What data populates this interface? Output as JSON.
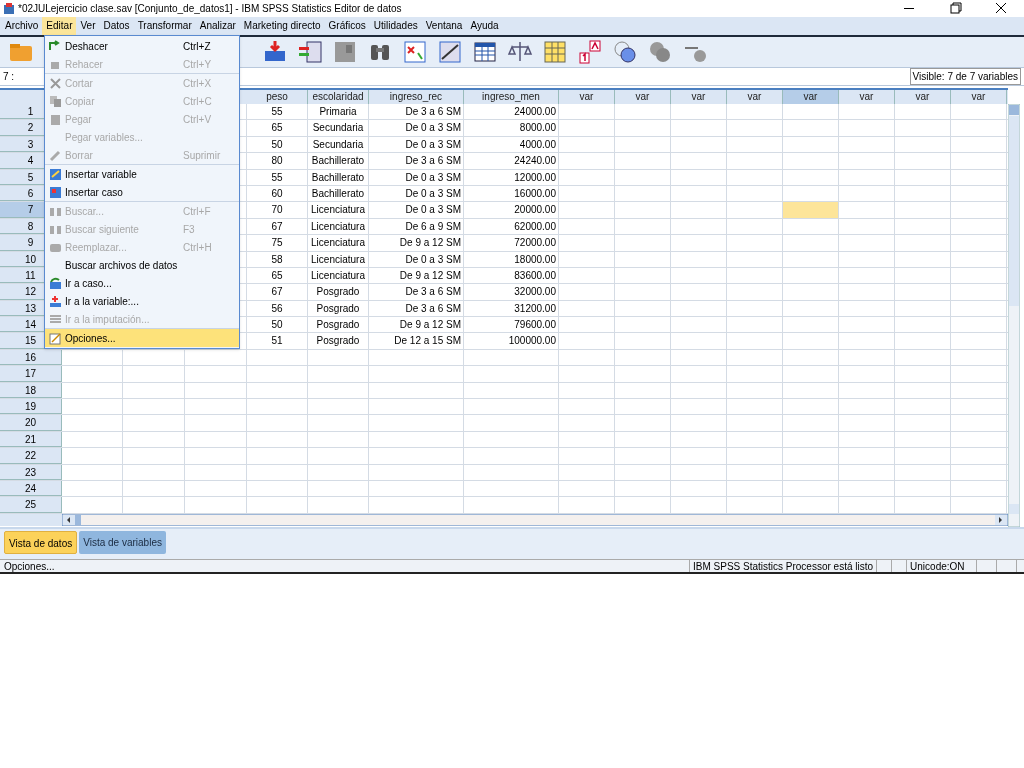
{
  "window": {
    "title": "*02JULejercicio clase.sav [Conjunto_de_datos1] - IBM SPSS Statistics Editor de datos"
  },
  "menu_bar": [
    {
      "label": "Archivo",
      "selected": false
    },
    {
      "label": "Editar",
      "selected": true
    },
    {
      "label": "Ver",
      "selected": false
    },
    {
      "label": "Datos",
      "selected": false
    },
    {
      "label": "Transformar",
      "selected": false
    },
    {
      "label": "Analizar",
      "selected": false
    },
    {
      "label": "Marketing directo",
      "selected": false
    },
    {
      "label": "Gráficos",
      "selected": false
    },
    {
      "label": "Utilidades",
      "selected": false
    },
    {
      "label": "Ventana",
      "selected": false
    },
    {
      "label": "Ayuda",
      "selected": false
    }
  ],
  "edit_menu": [
    {
      "label": "Deshacer",
      "shortcut": "Ctrl+Z",
      "disabled": false,
      "selected": false,
      "separator_before": false
    },
    {
      "label": "Rehacer",
      "shortcut": "Ctrl+Y",
      "disabled": true,
      "selected": false,
      "separator_before": false
    },
    {
      "label": "Cortar",
      "shortcut": "Ctrl+X",
      "disabled": true,
      "selected": false,
      "separator_before": true
    },
    {
      "label": "Copiar",
      "shortcut": "Ctrl+C",
      "disabled": true,
      "selected": false,
      "separator_before": false
    },
    {
      "label": "Pegar",
      "shortcut": "Ctrl+V",
      "disabled": true,
      "selected": false,
      "separator_before": false
    },
    {
      "label": "Pegar variables...",
      "disabled": true,
      "selected": false,
      "separator_before": false
    },
    {
      "label": "Borrar",
      "shortcut": "Suprimir",
      "disabled": true,
      "selected": false,
      "separator_before": false
    },
    {
      "label": "Insertar variable",
      "disabled": false,
      "selected": false,
      "separator_before": true
    },
    {
      "label": "Insertar caso",
      "disabled": false,
      "selected": false,
      "separator_before": false
    },
    {
      "label": "Buscar...",
      "shortcut": "Ctrl+F",
      "disabled": true,
      "selected": false,
      "separator_before": true
    },
    {
      "label": "Buscar siguiente",
      "shortcut": "F3",
      "disabled": true,
      "selected": false,
      "separator_before": false
    },
    {
      "label": "Reemplazar...",
      "shortcut": "Ctrl+H",
      "disabled": true,
      "selected": false,
      "separator_before": false
    },
    {
      "label": "Buscar archivos de datos",
      "disabled": false,
      "selected": false,
      "separator_before": false
    },
    {
      "label": "Ir a caso...",
      "disabled": false,
      "selected": false,
      "separator_before": false
    },
    {
      "label": "Ir a la variable:...",
      "disabled": false,
      "selected": false,
      "separator_before": false
    },
    {
      "label": "Ir a la imputación...",
      "disabled": true,
      "selected": false,
      "separator_before": false
    },
    {
      "label": "Opciones...",
      "disabled": false,
      "selected": true,
      "separator_before": true
    }
  ],
  "cell_reference": "7 :",
  "visible_vars": "Visible: 7 de 7 variables",
  "columns": [
    {
      "label": "peso",
      "selected": false
    },
    {
      "label": "escolaridad",
      "selected": false
    },
    {
      "label": "ingreso_rec",
      "selected": false
    },
    {
      "label": "ingreso_men",
      "selected": false
    },
    {
      "label": "var",
      "selected": false
    },
    {
      "label": "var",
      "selected": false
    },
    {
      "label": "var",
      "selected": false
    },
    {
      "label": "var",
      "selected": false
    },
    {
      "label": "var",
      "selected": true
    },
    {
      "label": "var",
      "selected": false
    },
    {
      "label": "var",
      "selected": false
    },
    {
      "label": "var",
      "selected": false
    }
  ],
  "rows": [
    {
      "number": "1",
      "selected": false,
      "peso": "55",
      "escolaridad": "Primaria",
      "ingreso_rec": "De 3 a 6 SM",
      "ingreso_men": "24000.00"
    },
    {
      "number": "2",
      "selected": false,
      "peso": "65",
      "escolaridad": "Secundaria",
      "ingreso_rec": "De 0 a 3 SM",
      "ingreso_men": "8000.00"
    },
    {
      "number": "3",
      "selected": false,
      "peso": "50",
      "escolaridad": "Secundaria",
      "ingreso_rec": "De 0 a 3 SM",
      "ingreso_men": "4000.00"
    },
    {
      "number": "4",
      "selected": false,
      "peso": "80",
      "escolaridad": "Bachillerato",
      "ingreso_rec": "De 3 a 6 SM",
      "ingreso_men": "24240.00"
    },
    {
      "number": "5",
      "selected": false,
      "peso": "55",
      "escolaridad": "Bachillerato",
      "ingreso_rec": "De 0 a 3 SM",
      "ingreso_men": "12000.00"
    },
    {
      "number": "6",
      "selected": false,
      "peso": "60",
      "escolaridad": "Bachillerato",
      "ingreso_rec": "De 0 a 3 SM",
      "ingreso_men": "16000.00"
    },
    {
      "number": "7",
      "selected": true,
      "peso": "70",
      "escolaridad": "Licenciatura",
      "ingreso_rec": "De 0 a 3 SM",
      "ingreso_men": "20000.00"
    },
    {
      "number": "8",
      "selected": false,
      "peso": "67",
      "escolaridad": "Licenciatura",
      "ingreso_rec": "De 6 a 9 SM",
      "ingreso_men": "62000.00"
    },
    {
      "number": "9",
      "selected": false,
      "peso": "75",
      "escolaridad": "Licenciatura",
      "ingreso_rec": "De 9 a 12 SM",
      "ingreso_men": "72000.00"
    },
    {
      "number": "10",
      "selected": false,
      "peso": "58",
      "escolaridad": "Licenciatura",
      "ingreso_rec": "De 0 a 3 SM",
      "ingreso_men": "18000.00"
    },
    {
      "number": "11",
      "selected": false,
      "peso": "65",
      "escolaridad": "Licenciatura",
      "ingreso_rec": "De 9 a 12 SM",
      "ingreso_men": "83600.00"
    },
    {
      "number": "12",
      "selected": false,
      "peso": "67",
      "escolaridad": "Posgrado",
      "ingreso_rec": "De 3 a 6 SM",
      "ingreso_men": "32000.00"
    },
    {
      "number": "13",
      "selected": false,
      "peso": "56",
      "escolaridad": "Posgrado",
      "ingreso_rec": "De 3 a 6 SM",
      "ingreso_men": "31200.00"
    },
    {
      "number": "14",
      "selected": false,
      "peso": "50",
      "escolaridad": "Posgrado",
      "ingreso_rec": "De 9 a 12 SM",
      "ingreso_men": "79600.00"
    },
    {
      "number": "15",
      "selected": false,
      "peso": "51",
      "escolaridad": "Posgrado",
      "ingreso_rec": "De 12 a 15 SM",
      "ingreso_men": "100000.00"
    },
    {
      "number": "16",
      "selected": false
    },
    {
      "number": "17",
      "selected": false
    },
    {
      "number": "18",
      "selected": false
    },
    {
      "number": "19",
      "selected": false
    },
    {
      "number": "20",
      "selected": false
    },
    {
      "number": "21",
      "selected": false
    },
    {
      "number": "22",
      "selected": false
    },
    {
      "number": "23",
      "selected": false
    },
    {
      "number": "24",
      "selected": false
    },
    {
      "number": "25",
      "selected": false
    }
  ],
  "view_tabs": [
    {
      "label": "Vista de datos",
      "selected": true
    },
    {
      "label": "Vista de variables",
      "selected": false
    }
  ],
  "status_bar": {
    "message": "Opciones...",
    "processor": "IBM SPSS Statistics Processor está listo",
    "encoding": "Unicode:ON"
  }
}
